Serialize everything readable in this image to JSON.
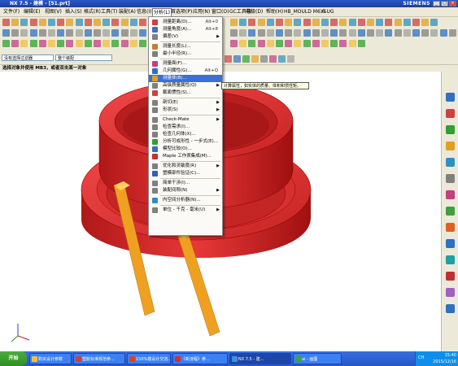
{
  "titlebar": {
    "title": "NX 7.5 - 建模 - [51.prt]",
    "brand": "SIEMENS",
    "min": "_",
    "max": "□",
    "close": "×"
  },
  "menubar": {
    "items": [
      {
        "label": "文件(F)"
      },
      {
        "label": "编辑(E)"
      },
      {
        "label": "视图(V)"
      },
      {
        "label": "插入(S)"
      },
      {
        "label": "格式(R)"
      },
      {
        "label": "工具(T)"
      },
      {
        "label": "装配(A)"
      },
      {
        "label": "信息(I)"
      },
      {
        "label": "分析(L)"
      },
      {
        "label": "首选项(P)"
      },
      {
        "label": "应用(N)"
      },
      {
        "label": "窗口(O)"
      },
      {
        "label": "GC工具箱"
      },
      {
        "label": "电极(D)"
      },
      {
        "label": "帮助(H)"
      },
      {
        "label": "HB_MOULD M6.6"
      },
      {
        "label": "YSUG"
      }
    ],
    "active_index": 8
  },
  "filterbar": {
    "filter": "没有选择过滤器",
    "scope": "整个装配"
  },
  "prompt": "选择对象并使用 MB3，或者双击某一对象",
  "dropdown": {
    "items": [
      {
        "label": "测量距离(D)...",
        "accel": "Alt+0",
        "color": "#d04040"
      },
      {
        "label": "测量角度(A)...",
        "accel": "Alt+8",
        "color": "#4070c0"
      },
      {
        "label": "偏差(V)",
        "submenu": true,
        "color": "#808080"
      },
      {
        "sep": true
      },
      {
        "label": "测量长度(L)...",
        "color": "#c08030"
      },
      {
        "label": "最小半径(R)...",
        "color": "#808080"
      },
      {
        "sep": true
      },
      {
        "label": "测量面(F)...",
        "color": "#c04080"
      },
      {
        "label": "几何属性(G)...",
        "accel": "Alt+Q",
        "color": "#3070c0"
      },
      {
        "label": "测量体(B)...",
        "highlight": true,
        "color": "#e0a020"
      },
      {
        "label": "高级质量属性(Q)",
        "submenu": true,
        "color": "#808080"
      },
      {
        "label": "截面惯性(S)...",
        "color": "#d04040"
      },
      {
        "sep": true
      },
      {
        "label": "剖切(E)",
        "submenu": true,
        "color": "#808080"
      },
      {
        "label": "形状(S)",
        "submenu": true,
        "color": "#808080"
      },
      {
        "sep": true
      },
      {
        "label": "Check-Mate",
        "submenu": true,
        "color": "#808080"
      },
      {
        "label": "检查需求(I)...",
        "color": "#808080"
      },
      {
        "label": "检查几何体(X)...",
        "color": "#808080"
      },
      {
        "label": "分析可成形性 - 一步式(E)...",
        "color": "#30a030"
      },
      {
        "label": "模型比较(O)...",
        "color": "#3070c0"
      },
      {
        "label": "Maple 工作表集成(M)...",
        "color": "#c03030"
      },
      {
        "sep": true
      },
      {
        "label": "优化和灵敏度(R)",
        "submenu": true,
        "color": "#808080"
      },
      {
        "label": "塑模部件验证(C)...",
        "color": "#3060c0"
      },
      {
        "sep": true
      },
      {
        "label": "简单干涉(I)...",
        "color": "#808080"
      },
      {
        "label": "装配间隙(N)",
        "submenu": true,
        "color": "#808080"
      },
      {
        "sep": true
      },
      {
        "label": "内空间分析器(N)...",
        "color": "#3090c0"
      },
      {
        "sep": true
      },
      {
        "label": "单位 - 千克 - 毫米(U)",
        "submenu": true,
        "color": "#808080"
      }
    ]
  },
  "tooltip": "计算属性，如实体的质量、体积和惯性矩。",
  "taskbar": {
    "start": "开始",
    "tasks": [
      {
        "label": "购买设计参数",
        "color": "#f0c040"
      },
      {
        "label": "塑胶标准规范参...",
        "color": "#d04040"
      },
      {
        "label": "150%模设计交流...",
        "color": "#e04020"
      },
      {
        "label": "《新流程》参...",
        "color": "#d03030"
      },
      {
        "label": "NX 7.5 - 建...",
        "color": "#4090e0",
        "active": true
      },
      {
        "label": "ai - 画图",
        "color": "#40a040"
      }
    ],
    "lang": "CH",
    "time": "15:40",
    "date": "2015/12/16"
  },
  "colors": {
    "part_red": "#e03030",
    "pin_orange": "#f0a020",
    "menu_highlight": "#3a6fd8"
  }
}
